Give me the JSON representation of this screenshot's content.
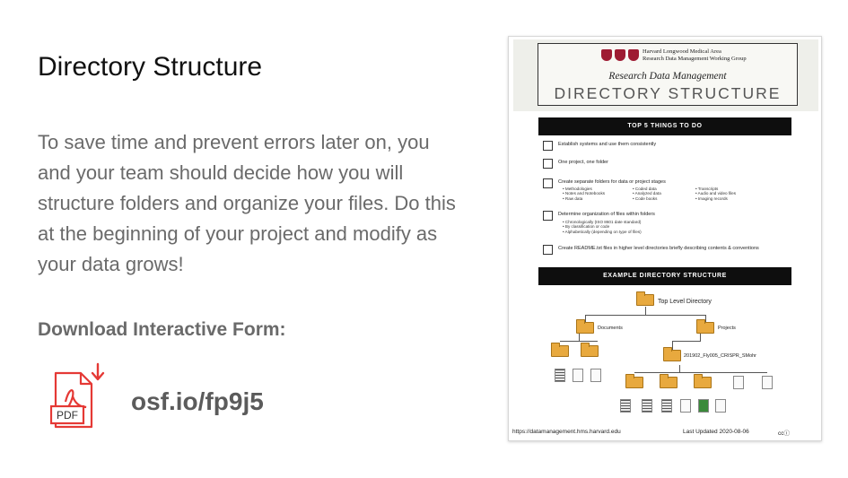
{
  "slide": {
    "title": "Directory Structure",
    "body": "To save time and prevent errors later on, you and your team should decide how you will structure folders and organize your files. Do this at the beginning of your project and modify as your data grows!",
    "download_label": "Download Interactive Form:",
    "link_text": "osf.io/fp9j5",
    "pdf_icon_text": "PDF",
    "icon_color": "#e53935"
  },
  "poster": {
    "org_line1": "Harvard Longwood Medical Area",
    "org_line2": "Research Data Management Working Group",
    "subtitle": "Research Data Management",
    "title": "DIRECTORY STRUCTURE",
    "top5_header": "TOP 5 THINGS TO DO",
    "checklist": [
      "Establish systems and use them consistently",
      "One project, one folder",
      "Create separate folders for data or project stages",
      "Determine organization of files within folders",
      "Create README.txt files in higher level directories briefly describing contents & conventions"
    ],
    "stages_col1": [
      "Methodologies",
      "Notes and Notebooks",
      "Raw data"
    ],
    "stages_col2": [
      "Coded data",
      "Analyzed data",
      "Code books"
    ],
    "stages_col3": [
      "Transcripts",
      "Audio and video files",
      "Imaging records"
    ],
    "org_options": [
      "Chronologically (ISO 8601 date standard)",
      "By classification or code",
      "Alphabetically (depending on type of files)"
    ],
    "example_header": "EXAMPLE DIRECTORY STRUCTURE",
    "tree": {
      "top": "Top Level Directory",
      "documents": "Documents",
      "projects": "Projects",
      "project_folder": "201902_Fly005_CRISPR_SMohr"
    },
    "footer_url": "https://datamanagement.hms.harvard.edu",
    "footer_updated": "Last Updated 2020-08-06",
    "footer_license": "ccⓘ"
  }
}
